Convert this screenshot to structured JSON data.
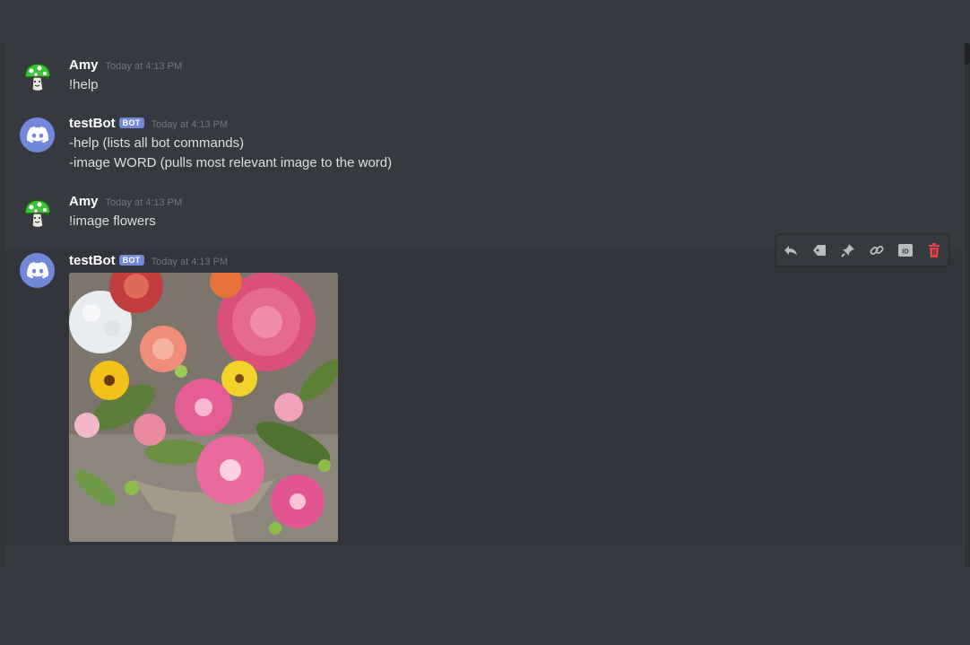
{
  "messages": [
    {
      "author": "Amy",
      "timestamp": "Today at 4:13 PM",
      "lines": [
        "!help"
      ],
      "avatar_icon": "green-mushroom-avatar"
    },
    {
      "author": "testBot",
      "badge": "BOT",
      "timestamp": "Today at 4:13 PM",
      "lines": [
        "-help (lists all bot commands)",
        "-image WORD (pulls most relevant image to the word)"
      ],
      "avatar_icon": "discord-logo-avatar"
    },
    {
      "author": "Amy",
      "timestamp": "Today at 4:13 PM",
      "lines": [
        "!image flowers"
      ],
      "avatar_icon": "green-mushroom-avatar"
    },
    {
      "author": "testBot",
      "badge": "BOT",
      "timestamp": "Today at 4:13 PM",
      "attachment": "flower-bouquet-image",
      "avatar_icon": "discord-logo-avatar"
    }
  ],
  "toolbar": {
    "icons": [
      "reply-icon",
      "tag-icon",
      "pin-icon",
      "link-icon",
      "id-icon",
      "delete-icon"
    ]
  },
  "colors": {
    "background": "#36393f",
    "bot_badge": "#7289da",
    "timestamp": "#72767d",
    "delete": "#ed4245"
  }
}
